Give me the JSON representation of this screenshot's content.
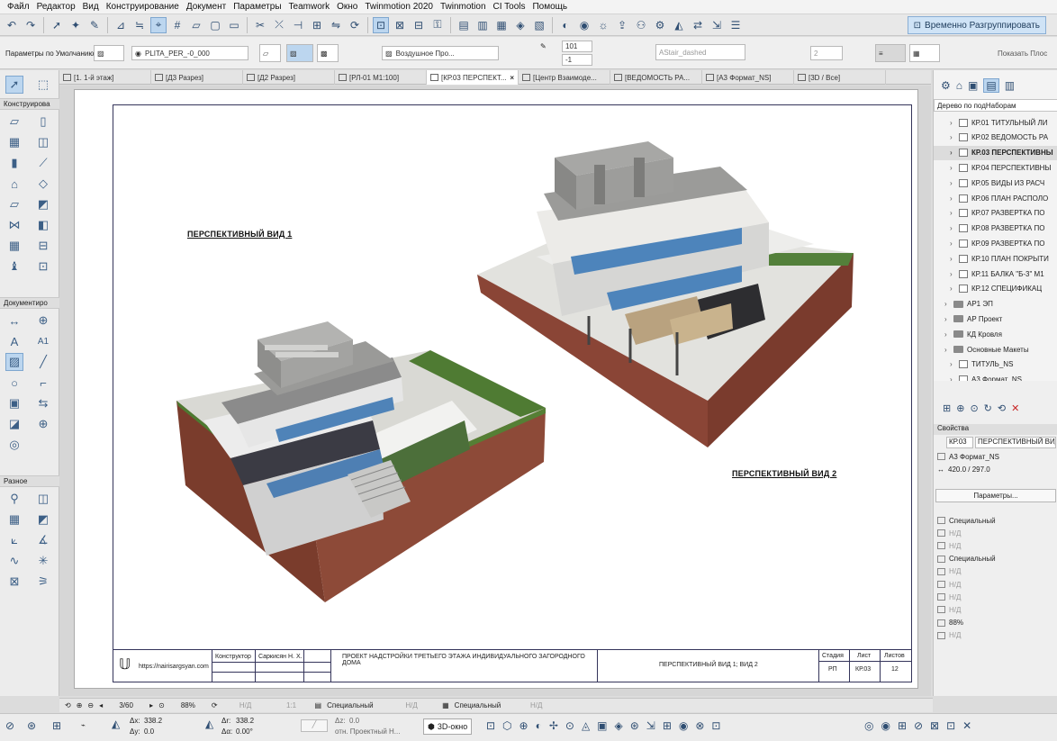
{
  "menu": [
    "Файл",
    "Редактор",
    "Вид",
    "Конструирование",
    "Документ",
    "Параметры",
    "Teamwork",
    "Окно",
    "Twinmotion 2020",
    "Twinmotion",
    "CI Tools",
    "Помощь"
  ],
  "toolbar": {
    "regroup_label": "Временно Разгруппировать"
  },
  "infobox": {
    "default_params": "Параметры по Умолчанию",
    "layer": "PLITA_PER_-0_000",
    "fill_name": "Воздушное Про...",
    "value1": "101",
    "value2": "-1",
    "linetype": "AStair_dashed",
    "pen_number": "2",
    "show_outline": "Показать Плос"
  },
  "tabs": [
    {
      "label": "[1. 1-й этаж]",
      "active": false
    },
    {
      "label": "[Д3 Разрез]",
      "active": false
    },
    {
      "label": "[Д2 Разрез]",
      "active": false
    },
    {
      "label": "[РЛ-01 М1:100]",
      "active": false
    },
    {
      "label": "[КР.03 ПЕРСПЕКТ...",
      "active": true
    },
    {
      "label": "[Центр Взаимоде...",
      "active": false
    },
    {
      "label": "[ВЕДОМОСТЬ РА...",
      "active": false
    },
    {
      "label": "[А3 Формат_NS]",
      "active": false
    },
    {
      "label": "[3D / Все]",
      "active": false
    }
  ],
  "toolbox": {
    "construct_header": "Конструирова",
    "document_header": "Документиро",
    "misc_header": "Разное",
    "text_tool_glyph": "A",
    "label_tool_glyph": "A1"
  },
  "sheet": {
    "view1_title": "ПЕРСПЕКТИВНЫЙ ВИД 1",
    "view2_title": "ПЕРСПЕКТИВНЫЙ ВИД 2",
    "stamp": {
      "website": "https://nairisargsyan.com",
      "role": "Конструктор",
      "person": "Саркисян Н. Х.",
      "project": "ПРОЕКТ НАДСТРОЙКИ ТРЕТЬЕГО ЭТАЖА ИНДИВИДУАЛЬНОГО ЗАГОРОДНОГО ДОМА",
      "sheet_name": "ПЕРСПЕКТИВНЫЙ ВИД 1; ВИД 2",
      "stage_label": "Стадия",
      "sheet_label": "Лист",
      "sheets_label": "Листов",
      "stage_value": "РП",
      "sheet_value": "КР.03",
      "sheets_value": "12"
    }
  },
  "navigator": {
    "header": "Дерево по подНаборам",
    "items": [
      {
        "label": "КР.01 ТИТУЛЬНЫЙ ЛИ",
        "kind": "layout",
        "selected": false,
        "indent": 1
      },
      {
        "label": "КР.02 ВЕДОМОСТЬ РА",
        "kind": "layout",
        "selected": false,
        "indent": 1
      },
      {
        "label": "КР.03 ПЕРСПЕКТИВНЫ",
        "kind": "layout",
        "selected": true,
        "indent": 1
      },
      {
        "label": "КР.04 ПЕРСПЕКТИВНЫ",
        "kind": "layout",
        "selected": false,
        "indent": 1
      },
      {
        "label": "КР.05 ВИДЫ ИЗ РАСЧ",
        "kind": "layout",
        "selected": false,
        "indent": 1
      },
      {
        "label": "КР.06 ПЛАН РАСПОЛО",
        "kind": "layout",
        "selected": false,
        "indent": 1
      },
      {
        "label": "КР.07 РАЗВЕРТКА ПО",
        "kind": "layout",
        "selected": false,
        "indent": 1
      },
      {
        "label": "КР.08 РАЗВЕРТКА ПО",
        "kind": "layout",
        "selected": false,
        "indent": 1
      },
      {
        "label": "КР.09 РАЗВЕРТКА ПО",
        "kind": "layout",
        "selected": false,
        "indent": 1
      },
      {
        "label": "КР.10 ПЛАН ПОКРЫТИ",
        "kind": "layout",
        "selected": false,
        "indent": 1
      },
      {
        "label": "КР.11 БАЛКА \"Б-3\" М1",
        "kind": "layout",
        "selected": false,
        "indent": 1
      },
      {
        "label": "КР.12 СПЕЦИФИКАЦ",
        "kind": "layout",
        "selected": false,
        "indent": 1
      },
      {
        "label": "АР1 ЭП",
        "kind": "folder",
        "selected": false,
        "indent": 0
      },
      {
        "label": "АР Проект",
        "kind": "folder",
        "selected": false,
        "indent": 0
      },
      {
        "label": "КД Кровля",
        "kind": "folder",
        "selected": false,
        "indent": 0
      },
      {
        "label": "Основные Макеты",
        "kind": "folder",
        "selected": false,
        "indent": 0
      },
      {
        "label": "ТИТУЛЬ_NS",
        "kind": "layout",
        "selected": false,
        "indent": 1
      },
      {
        "label": "А3 Формат_NS",
        "kind": "layout",
        "selected": false,
        "indent": 1
      }
    ]
  },
  "properties": {
    "header": "Свойства",
    "id_value": "КР.03",
    "name_value": "ПЕРСПЕКТИВНЫЙ ВИД",
    "master": "А3 Формат_NS",
    "size": "420.0 / 297.0",
    "params_button": "Параметры...",
    "rows": [
      "Специальный",
      "Н/Д",
      "Н/Д",
      "Специальный",
      "Н/Д",
      "Н/Д",
      "Н/Д",
      "Н/Д",
      "88%",
      "Н/Д"
    ]
  },
  "statusbar": {
    "page": "3/60",
    "zoom": "88%",
    "nd1": "Н/Д",
    "scale": "1:1",
    "special1": "Специальный",
    "nd2": "Н/Д",
    "special2": "Специальный",
    "nd3": "Н/Д"
  },
  "coords": {
    "dx_label": "Δx:",
    "dx": "338.2",
    "dy_label": "Δy:",
    "dy": "0.0",
    "dr_label": "Δr:",
    "dr": "338.2",
    "da_label": "Δα:",
    "da": "0.00°",
    "dz_label": "Δz:",
    "dz": "0.0",
    "ref": "отн. Проектный Н...",
    "view3d": "3D-окно"
  }
}
